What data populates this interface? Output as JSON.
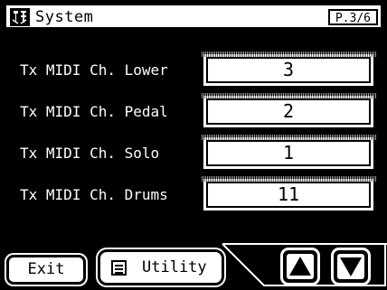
{
  "header": {
    "title": "System",
    "page_indicator": "P.3/6",
    "icon": "system-tools-icon"
  },
  "rows": [
    {
      "label": "Tx MIDI Ch. Lower",
      "value": "3"
    },
    {
      "label": "Tx MIDI Ch. Pedal",
      "value": "2"
    },
    {
      "label": "Tx MIDI Ch. Solo",
      "value": "1"
    },
    {
      "label": "Tx MIDI Ch. Drums",
      "value": "11"
    }
  ],
  "footer": {
    "exit_label": "Exit",
    "utility_label": "Utility",
    "utility_icon": "list-icon",
    "up_icon": "triangle-up-icon",
    "down_icon": "triangle-down-icon"
  },
  "colors": {
    "background": "#000000",
    "foreground": "#ffffff"
  }
}
